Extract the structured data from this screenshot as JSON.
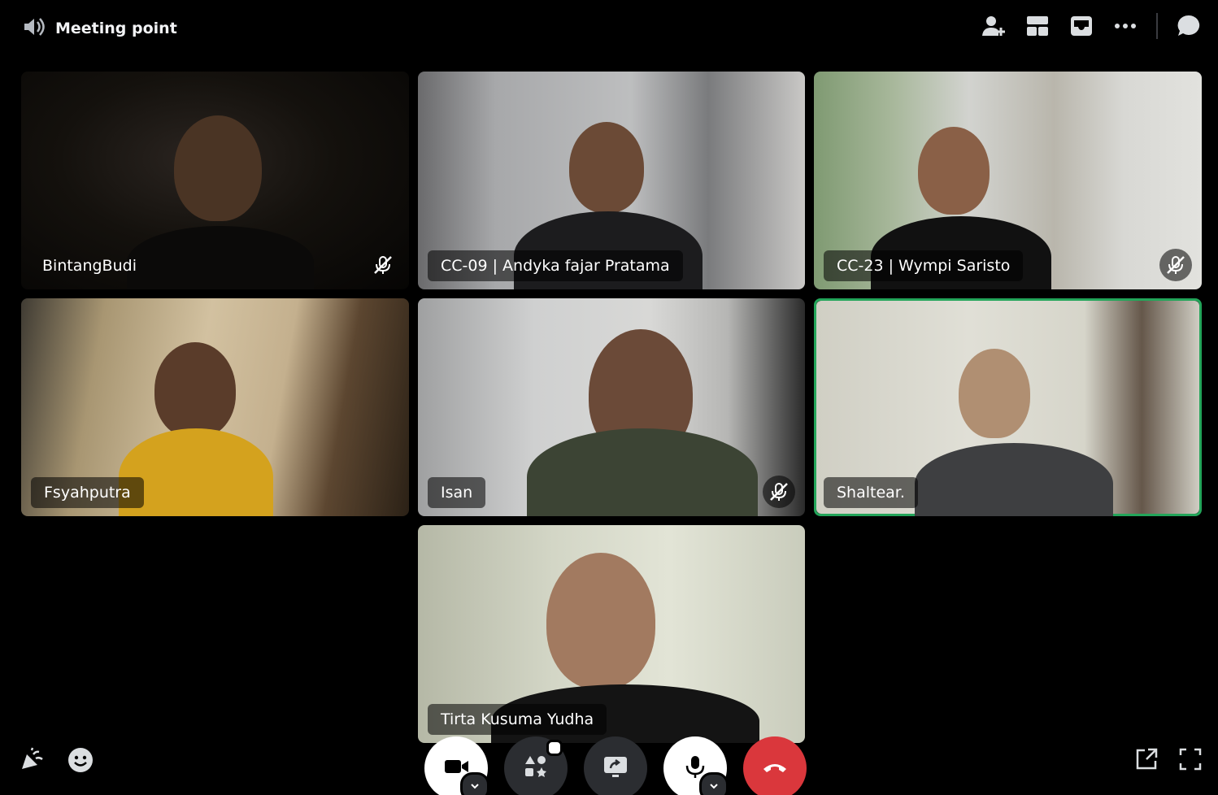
{
  "channel": {
    "title": "Meeting point",
    "icon": "speaker-icon"
  },
  "top_actions": [
    "invite-people-icon",
    "grid-layout-icon",
    "inbox-icon",
    "more-icon",
    "chat-icon"
  ],
  "participants": [
    {
      "name": "BintangBudi",
      "muted": true,
      "speaking": false
    },
    {
      "name": "CC-09 | Andyka fajar Pratama",
      "muted": false,
      "speaking": false
    },
    {
      "name": "CC-23 | Wympi Saristo",
      "muted": true,
      "speaking": false
    },
    {
      "name": "Fsyahputra",
      "muted": false,
      "speaking": false
    },
    {
      "name": "Isan",
      "muted": true,
      "speaking": false
    },
    {
      "name": "Shaltear.",
      "muted": false,
      "speaking": true
    },
    {
      "name": "Tirta Kusuma Yudha",
      "muted": false,
      "speaking": false
    }
  ],
  "bottom_controls": [
    "camera-icon",
    "activities-icon",
    "screen-share-icon",
    "microphone-icon",
    "hang-up-icon"
  ],
  "bottom_left": [
    "soundboard-icon",
    "emoji-icon"
  ],
  "bottom_right": [
    "popout-icon",
    "fullscreen-icon"
  ],
  "colors": {
    "speaking_border": "#23a55a",
    "hangup": "#da373c",
    "bar": "#2b2d31"
  }
}
